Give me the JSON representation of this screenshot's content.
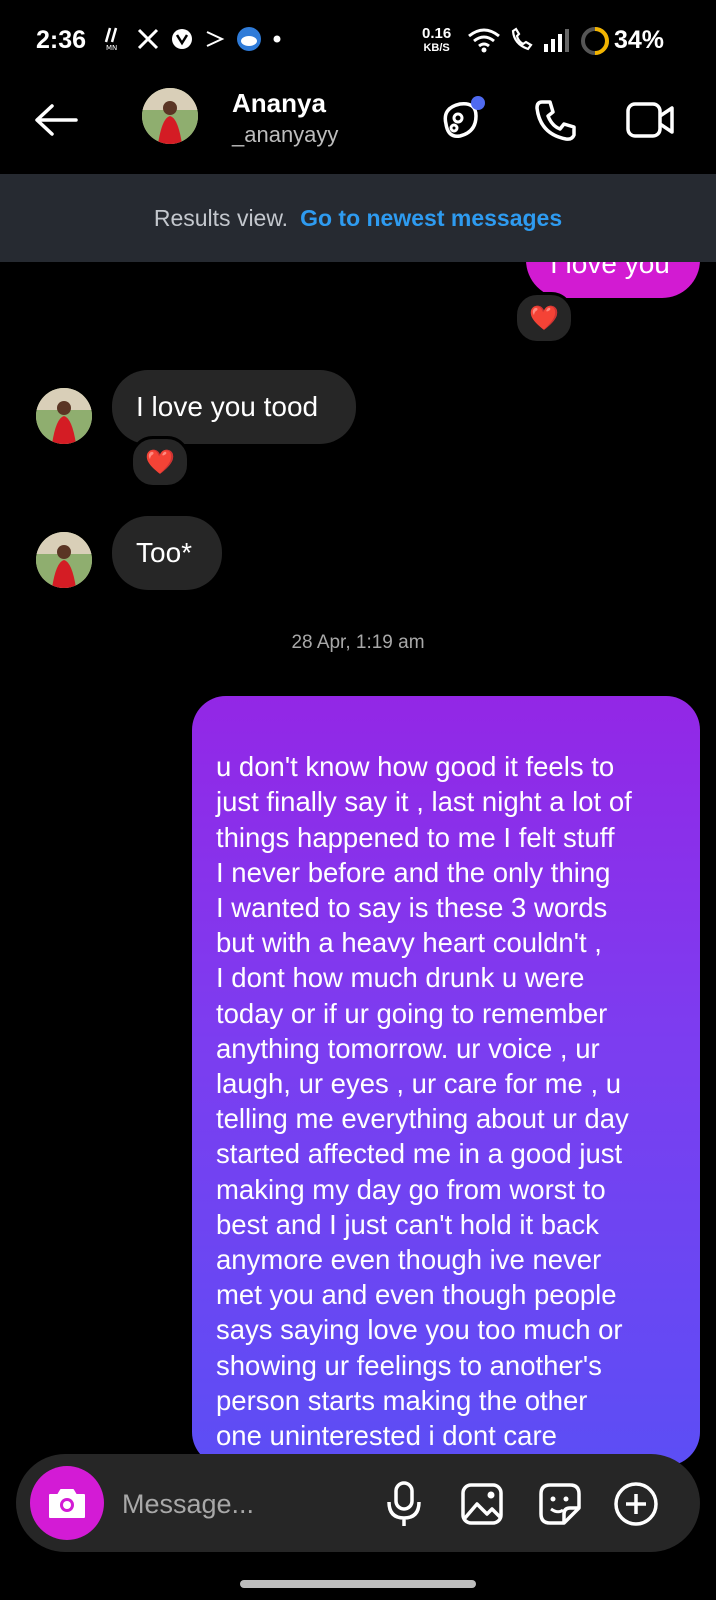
{
  "status_bar": {
    "time": "2:36",
    "net_speed_value": "0.16",
    "net_speed_unit": "KB/S",
    "battery": "34%"
  },
  "header": {
    "name": "Ananya",
    "handle": "_ananyayy",
    "icons": [
      "back-arrow-icon",
      "avatar",
      "effects-icon",
      "phone-icon",
      "video-camera-icon"
    ]
  },
  "banner": {
    "label": "Results view.",
    "link": "Go to newest messages"
  },
  "messages": {
    "sent_top_partial": "I love you",
    "sent_top_reaction": "❤️",
    "recv1": "I love you tood",
    "recv1_reaction": "❤️",
    "recv2": "Too*",
    "timestamp": "28 Apr, 1:19 am",
    "sent_long": "u don't know how good it feels to\njust finally say it , last night a lot of\nthings happened to me I felt stuff\nI never before and the only thing\nI wanted to say is these 3 words\nbut with a heavy heart couldn't ,\nI dont how much drunk u were\ntoday or if ur going to remember\nanything tomorrow. ur voice , ur\nlaugh, ur eyes , ur care for me , u\ntelling me everything about ur day\nstarted affected me in a good just\nmaking my day go from worst to\nbest and I just can't hold it back\nanymore even though ive never\nmet you and even though people\nsays saying love you too much or\nshowing ur feelings to another's\nperson starts making the other\none uninterested i dont care\ncause I love you Ananya"
  },
  "composer": {
    "placeholder": "Message..."
  },
  "colors": {
    "background": "#000000",
    "incoming_bubble": "#262626",
    "sent_bubble_top": "#9327e6",
    "sent_bubble_bottom": "#5c4ef5",
    "link": "#2e9bf0",
    "camera_button": "#d31bd5"
  }
}
